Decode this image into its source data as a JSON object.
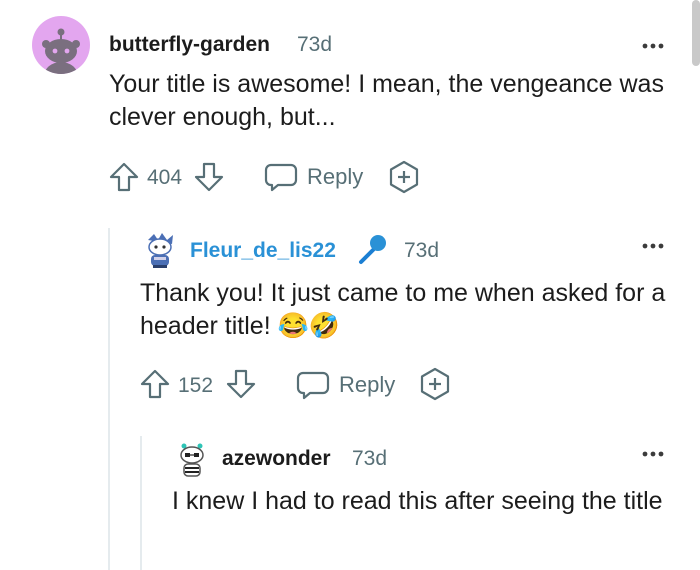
{
  "comments": [
    {
      "username": "butterfly-garden",
      "time": "73d",
      "body": "Your title is awesome! I mean, the vengeance was clever enough, but...",
      "votes": "404",
      "reply_label": "Reply",
      "username_color": "#1c1c1c",
      "avatar_bg": "#e3a6ef"
    },
    {
      "username": "Fleur_de_lis22",
      "time": "73d",
      "body": "Thank you! It just came to me when asked for a header title! 😂🤣",
      "votes": "152",
      "reply_label": "Reply",
      "username_color": "#2a91d6",
      "badge_icon": "microphone-icon"
    },
    {
      "username": "azewonder",
      "time": "73d",
      "body": "I knew I had to read this after seeing the title",
      "username_color": "#1c1c1c"
    }
  ]
}
